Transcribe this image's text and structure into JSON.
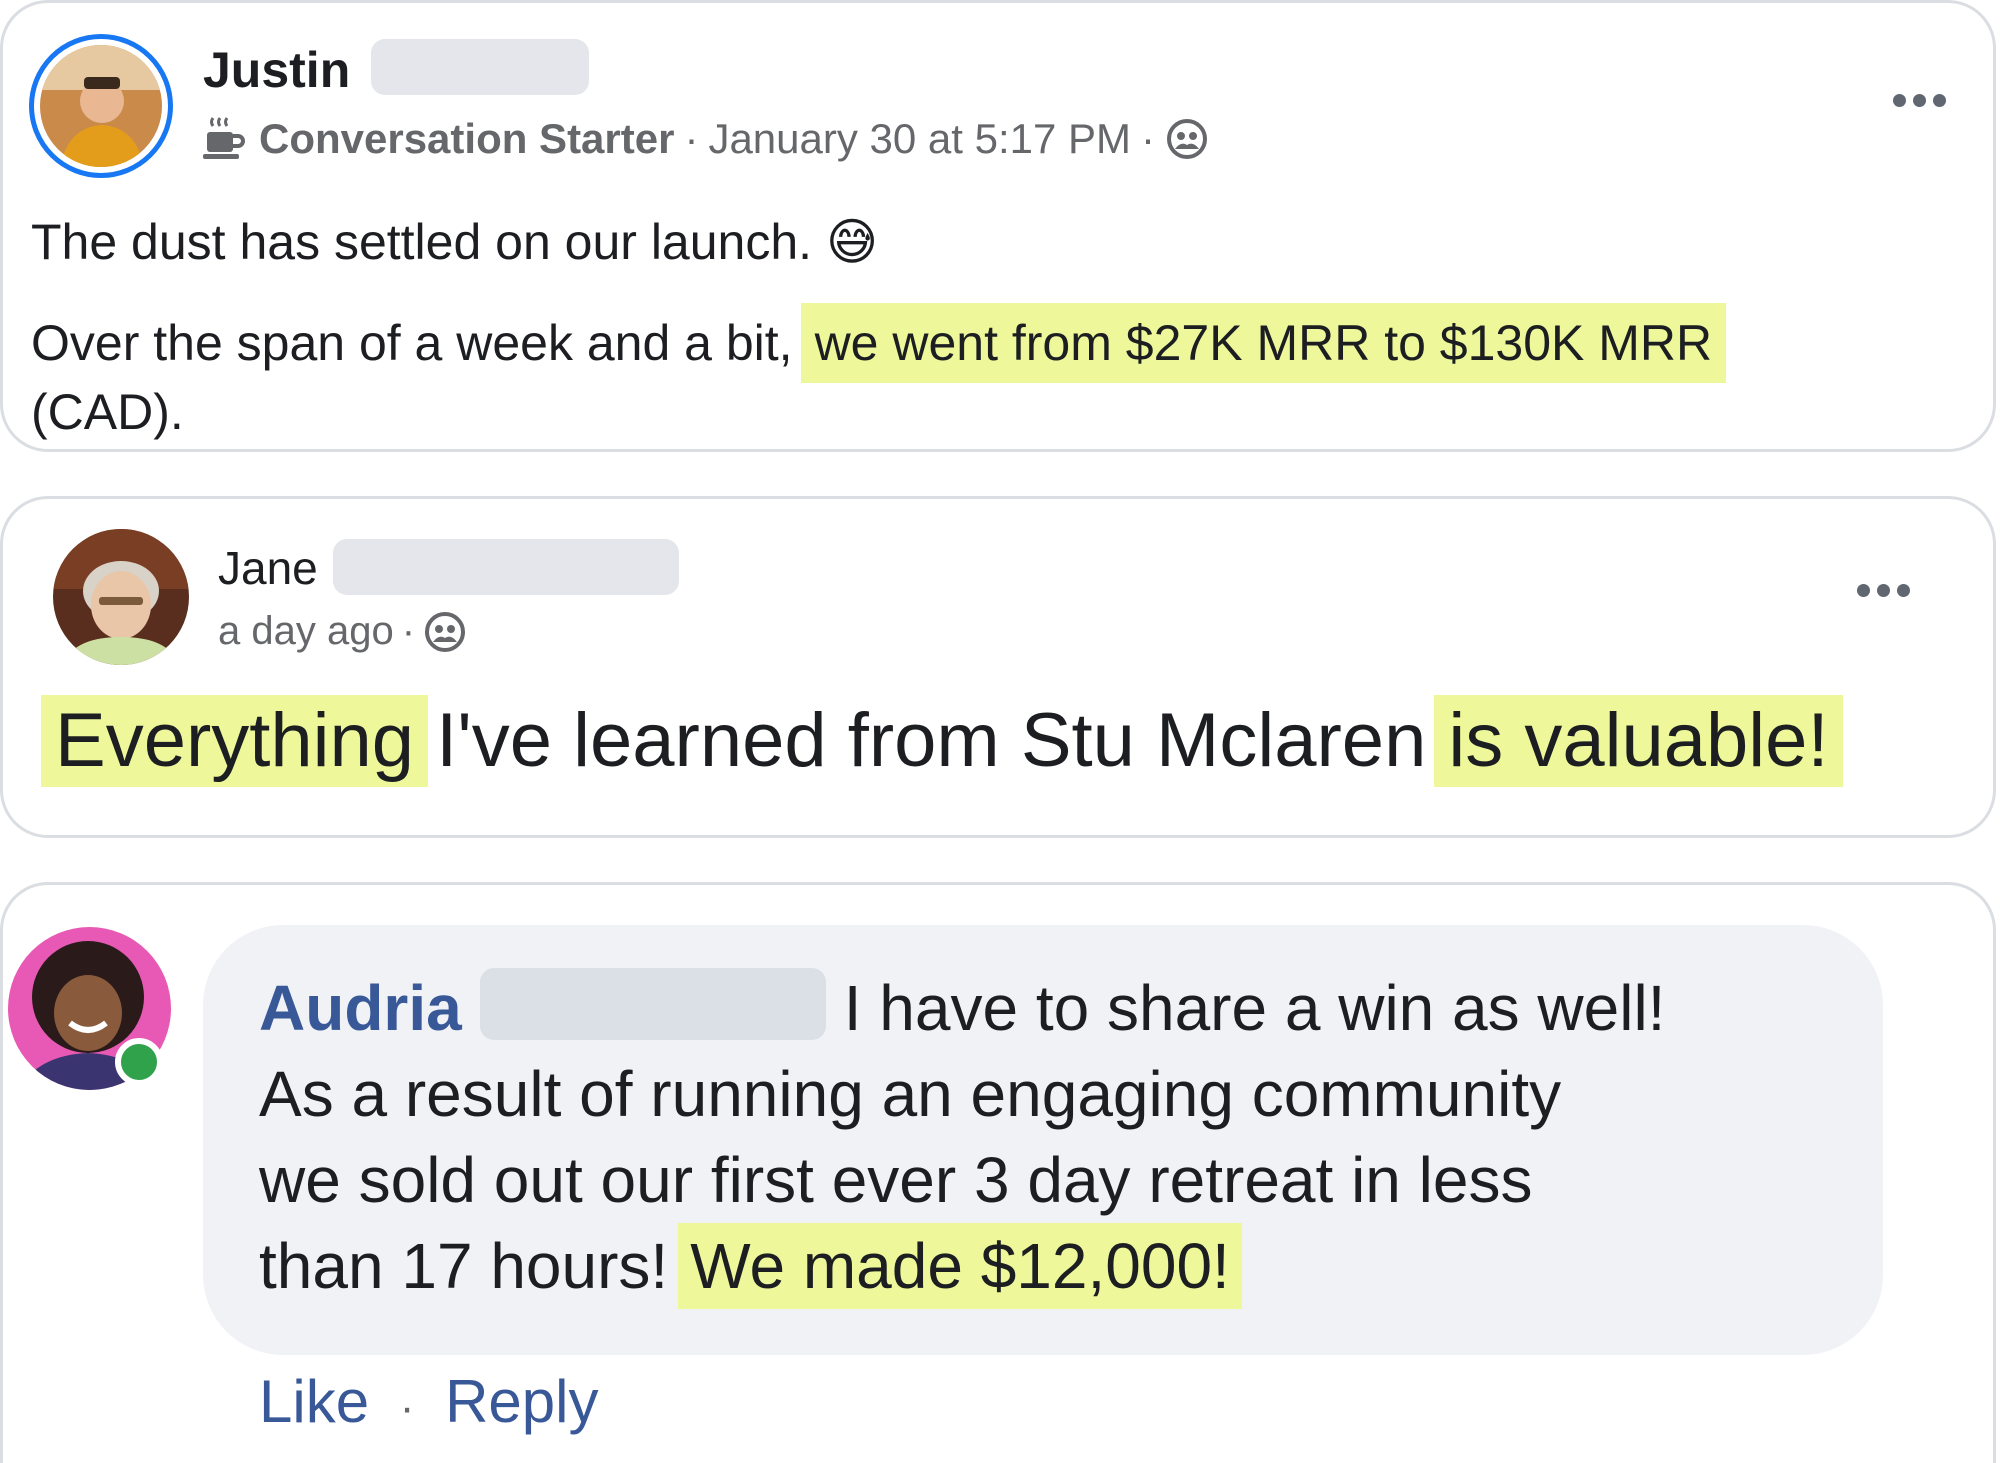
{
  "post1": {
    "author": "Justin",
    "badge": "Conversation Starter",
    "separator": "·",
    "timestamp": "January 30 at 5:17 PM",
    "line1": "The dust has settled on our launch.",
    "emoji": "😅",
    "line2_plain": "Over the span of a week and a bit,",
    "line2_highlight": "we went from $27K MRR to $130K MRR",
    "line3": "(CAD).",
    "privacy_icon": "group-icon",
    "badge_icon": "coffee-cup-icon"
  },
  "post2": {
    "author": "Jane",
    "timestamp": "a day ago",
    "separator": "·",
    "highlight_start": "Everything",
    "plain_middle": "I've learned from Stu Mclaren",
    "highlight_end": "is valuable!",
    "privacy_icon": "group-icon"
  },
  "comment": {
    "author": "Audria",
    "line1": "I have to share a win as well!",
    "line2": "As a result of running an engaging community",
    "line3": "we sold out our first ever 3 day retreat in less",
    "line4_plain": "than 17 hours!",
    "line4_highlight": "We made $12,000!",
    "like_label": "Like",
    "separator": "·",
    "reply_label": "Reply",
    "online_status_color": "#31a24c"
  },
  "colors": {
    "highlight": "#eef89a",
    "link_blue": "#385898",
    "meta_gray": "#65676b",
    "ring_blue": "#1877f2"
  }
}
